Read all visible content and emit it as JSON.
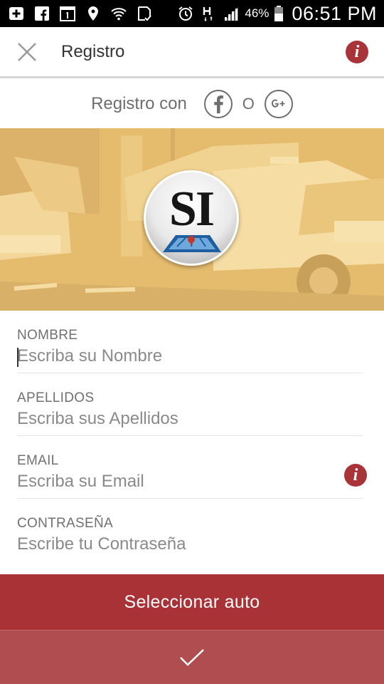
{
  "status_bar": {
    "battery_percent": "46%",
    "time": "06:51 PM",
    "icons": [
      "add-box-icon",
      "facebook-icon",
      "calendar-icon",
      "location-icon",
      "wifi-icon",
      "download-check-icon",
      "alarm-icon",
      "h-signal-icon",
      "signal-icon",
      "battery-icon"
    ]
  },
  "app_bar": {
    "title": "Registro"
  },
  "social": {
    "label": "Registro con",
    "separator": "O"
  },
  "banner": {
    "logo_text": "SI"
  },
  "form": {
    "fields": [
      {
        "label": "NOMBRE",
        "placeholder": "Escriba su Nombre"
      },
      {
        "label": "APELLIDOS",
        "placeholder": "Escriba sus Apellidos"
      },
      {
        "label": "EMAIL",
        "placeholder": "Escriba su Email"
      },
      {
        "label": "CONTRASEÑA",
        "placeholder": "Escribe tu Contraseña"
      }
    ]
  },
  "actions": {
    "select_car": "Seleccionar auto"
  },
  "colors": {
    "primary": "#a93237",
    "primary_light": "#b04d51",
    "banner": "#e5bb6e"
  }
}
